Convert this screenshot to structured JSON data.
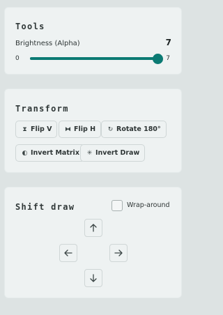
{
  "tools": {
    "title": "Tools",
    "brightness_label": "Brightness (Alpha)",
    "brightness_value": "7",
    "range_min": "0",
    "range_max": "7",
    "slider_fraction": 1.0
  },
  "transform": {
    "title": "Transform",
    "buttons": [
      {
        "label": "Flip V",
        "icon": "flip-vertical-icon"
      },
      {
        "label": "Flip H",
        "icon": "flip-horizontal-icon"
      },
      {
        "label": "Rotate 180°",
        "icon": "rotate-icon"
      },
      {
        "label": "Invert Matrix",
        "icon": "contrast-icon"
      },
      {
        "label": "Invert Draw",
        "icon": "sparkle-icon"
      }
    ]
  },
  "shift": {
    "title": "Shift draw",
    "wrap_label": "Wrap-around",
    "wrap_checked": false,
    "arrows": [
      "arrow-up-icon",
      "arrow-left-icon",
      "arrow-right-icon",
      "arrow-down-icon"
    ]
  },
  "colors": {
    "accent": "#0b7a73",
    "background": "#dde3e3",
    "panel": "#eef2f2"
  }
}
